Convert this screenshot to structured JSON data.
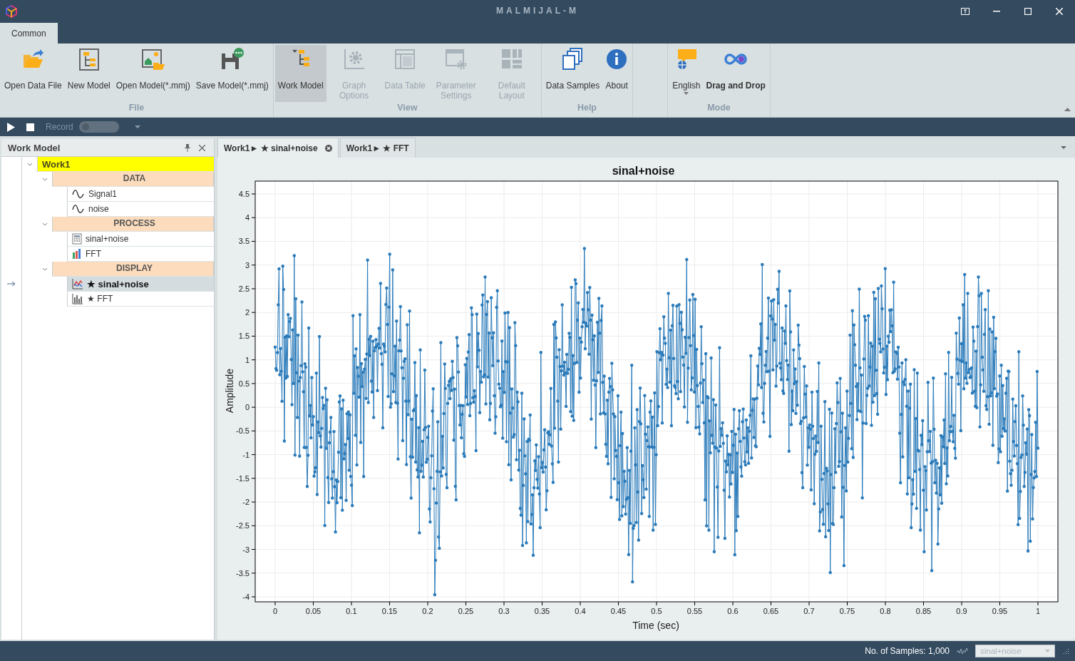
{
  "window": {
    "title": "MALMIJAL-M"
  },
  "ribbon_tabs": [
    {
      "label": "Common",
      "selected": true
    }
  ],
  "ribbon_groups": [
    {
      "label": "File",
      "buttons": [
        {
          "label": "Open Data File",
          "kind": "open-file",
          "disabled": false,
          "selected": false
        },
        {
          "label": "New Model",
          "kind": "new-model",
          "disabled": false,
          "selected": false
        },
        {
          "label": "Open Model(*.mmj)",
          "kind": "open-model",
          "disabled": false,
          "selected": false
        },
        {
          "label": "Save Model(*.mmj)",
          "kind": "save-model",
          "disabled": false,
          "selected": false
        }
      ]
    },
    {
      "label": "View",
      "buttons": [
        {
          "label": "Work Model",
          "kind": "work-model",
          "disabled": false,
          "selected": true
        },
        {
          "label": "Graph Options",
          "kind": "graph-options",
          "disabled": true,
          "selected": false
        },
        {
          "label": "Data Table",
          "kind": "data-table",
          "disabled": true,
          "selected": false
        },
        {
          "label": "Parameter Settings",
          "kind": "parameter-settings",
          "disabled": true,
          "selected": false
        },
        {
          "label": "Default Layout",
          "kind": "default-layout",
          "disabled": true,
          "selected": false
        }
      ]
    },
    {
      "label": "Help",
      "buttons": [
        {
          "label": "Data Samples",
          "kind": "data-samples",
          "disabled": false,
          "selected": false
        },
        {
          "label": "About",
          "kind": "about",
          "disabled": false,
          "selected": false
        }
      ]
    },
    {
      "label": "Mode",
      "buttons": [
        {
          "label": "English",
          "kind": "language",
          "disabled": false,
          "selected": false,
          "dropdown": true
        },
        {
          "label": "Drag and Drop",
          "kind": "drag-drop",
          "disabled": false,
          "selected": false,
          "bold": true
        }
      ]
    }
  ],
  "toolbar": {
    "record_label": "Record",
    "record_on": false
  },
  "work_model_panel": {
    "title": "Work Model",
    "tree": [
      {
        "label": "Work1",
        "kind": "root",
        "expanded": true,
        "children": [
          {
            "label": "DATA",
            "kind": "group",
            "expanded": true,
            "children": [
              {
                "label": "Signal1",
                "kind": "signal",
                "selected": false
              },
              {
                "label": "noise",
                "kind": "signal",
                "selected": false
              }
            ]
          },
          {
            "label": "PROCESS",
            "kind": "group",
            "expanded": true,
            "children": [
              {
                "label": "sinal+noise",
                "kind": "calculator",
                "selected": false
              },
              {
                "label": "FFT",
                "kind": "bars",
                "selected": false
              }
            ]
          },
          {
            "label": "DISPLAY",
            "kind": "group",
            "expanded": true,
            "children": [
              {
                "label": "★ sinal+noise",
                "kind": "line-chart",
                "selected": true
              },
              {
                "label": "★ FFT",
                "kind": "bar-chart",
                "selected": false
              }
            ]
          }
        ]
      }
    ]
  },
  "document_tabs": [
    {
      "label": "Work1► ★ sinal+noise",
      "selected": true
    },
    {
      "label": "Work1► ★ FFT",
      "selected": false
    }
  ],
  "plot": {
    "title": "sinal+noise",
    "xlabel": "Time (sec)",
    "ylabel": "Amplitude",
    "xticks": [
      "0",
      "0.05",
      "0.1",
      "0.15",
      "0.2",
      "0.25",
      "0.3",
      "0.35",
      "0.4",
      "0.45",
      "0.5",
      "0.55",
      "0.6",
      "0.65",
      "0.7",
      "0.75",
      "0.8",
      "0.85",
      "0.9",
      "0.95",
      "1"
    ],
    "yticks": [
      "4.5",
      "4",
      "3.5",
      "3",
      "2.5",
      "2",
      "1.5",
      "1",
      "0.5",
      "0",
      "-0.5",
      "-1",
      "-1.5",
      "-2",
      "-2.5",
      "-3",
      "-3.5",
      "-4"
    ]
  },
  "status_bar": {
    "samples": "No. of Samples: 1,000",
    "source": "sinal+noise"
  }
}
